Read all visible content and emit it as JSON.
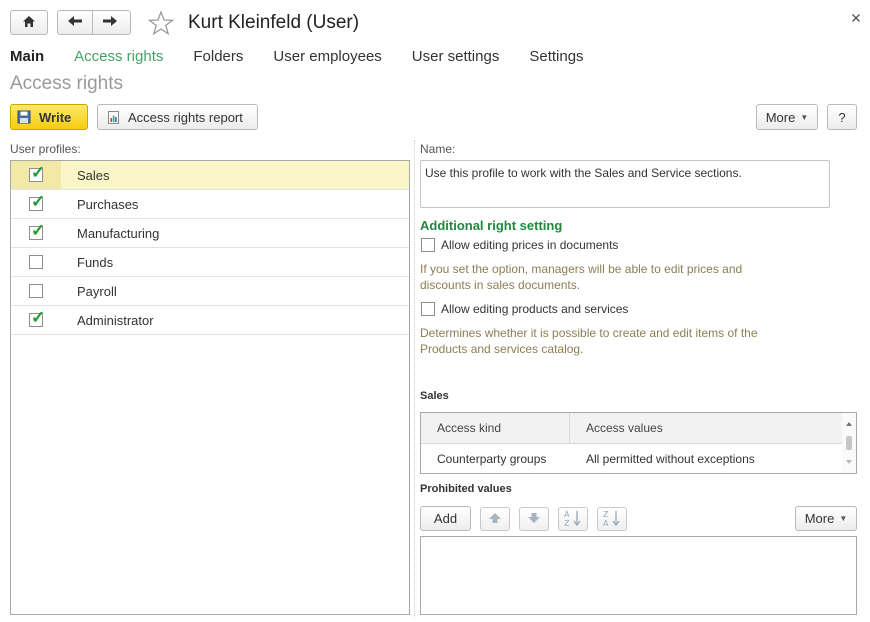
{
  "window": {
    "title": "Kurt Kleinfeld (User)"
  },
  "icons": {
    "home": "home-icon",
    "back": "arrow-left-icon",
    "forward": "arrow-right-icon",
    "favorite": "star-icon",
    "close": "close-icon"
  },
  "tabs": [
    {
      "label": "Main"
    },
    {
      "label": "Access rights"
    },
    {
      "label": "Folders"
    },
    {
      "label": "User employees"
    },
    {
      "label": "User settings"
    },
    {
      "label": "Settings"
    }
  ],
  "section_title": "Access rights",
  "toolbar": {
    "write_label": "Write",
    "report_label": "Access rights report",
    "more_label": "More",
    "help_label": "?"
  },
  "profiles": {
    "label": "User profiles:",
    "items": [
      {
        "name": "Sales",
        "checked": true
      },
      {
        "name": "Purchases",
        "checked": true
      },
      {
        "name": "Manufacturing",
        "checked": true
      },
      {
        "name": "Funds",
        "checked": false
      },
      {
        "name": "Payroll",
        "checked": false
      },
      {
        "name": "Administrator",
        "checked": true
      }
    ]
  },
  "details": {
    "name_label": "Name:",
    "name_value": "Use this profile to work with the Sales and Service sections.",
    "additional_title": "Additional right setting",
    "option1_label": "Allow editing prices in documents",
    "option1_hint_line1": "If you set the option, managers will be able to edit prices and",
    "option1_hint_line2": "discounts in sales documents.",
    "option2_label": "Allow editing products and services",
    "option2_hint_line1": "Determines whether it is possible to create and edit items of the",
    "option2_hint_line2": "Products and services catalog."
  },
  "sales_table": {
    "title": "Sales",
    "columns": [
      "Access kind",
      "Access values"
    ],
    "rows": [
      [
        "Counterparty groups",
        "All permitted without exceptions"
      ]
    ]
  },
  "prohibited": {
    "title": "Prohibited values",
    "add_label": "Add",
    "more_label": "More"
  },
  "colors": {
    "accent_green": "#1f8a3c",
    "active_tab": "#4aa064",
    "write_button": "#f5cd0f",
    "selected_row": "#fbf6c8",
    "hint_text": "#8c7d55"
  }
}
